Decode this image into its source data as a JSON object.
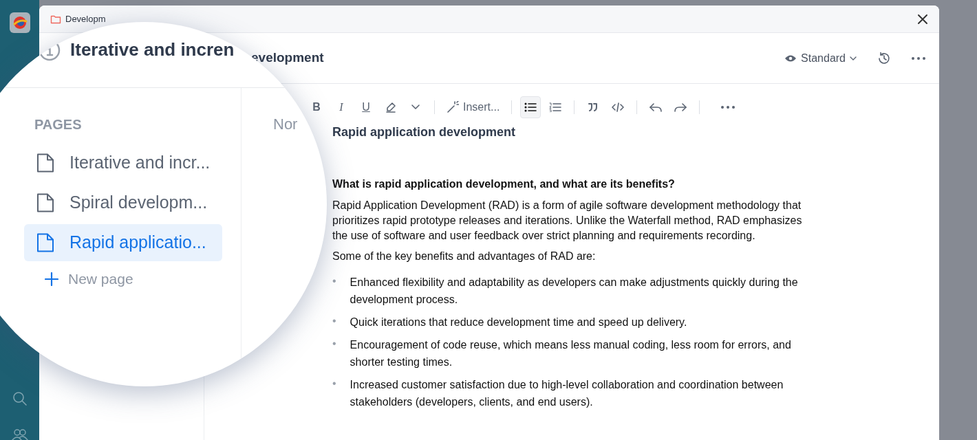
{
  "window": {
    "breadcrumb": "Developm",
    "title": "evelopment",
    "view_mode": "Standard"
  },
  "toolbar": [
    {
      "kind": "bold",
      "label": "B",
      "selected": false
    },
    {
      "kind": "italic",
      "label": "I",
      "selected": false
    },
    {
      "kind": "underline",
      "label": "U",
      "selected": false
    },
    {
      "kind": "highlight",
      "selected": false
    },
    {
      "kind": "dropdown",
      "selected": false
    },
    {
      "kind": "separator"
    },
    {
      "kind": "insert",
      "label": "Insert...",
      "selected": false
    },
    {
      "kind": "separator"
    },
    {
      "kind": "bullets",
      "selected": true
    },
    {
      "kind": "numbers",
      "selected": false
    },
    {
      "kind": "separator"
    },
    {
      "kind": "quote",
      "selected": false
    },
    {
      "kind": "code",
      "selected": false
    },
    {
      "kind": "separator"
    },
    {
      "kind": "undo",
      "selected": false
    },
    {
      "kind": "redo",
      "selected": false
    },
    {
      "kind": "separator"
    },
    {
      "kind": "more",
      "selected": false
    }
  ],
  "document": {
    "heading": "Rapid application development",
    "subheading": "What is rapid application development, and what are its benefits?",
    "marker": "•",
    "paragraphs": [
      "Rapid Application Development (RAD) is a form of agile software development methodology that prioritizes rapid prototype releases and iterations. Unlike the Waterfall method, RAD emphasizes the use of software and user feedback over strict planning and requirements recording.",
      "Some of the key benefits and advantages of RAD are:"
    ],
    "bullets": [
      "Enhanced flexibility and adaptability as developers can make adjustments quickly during the development process.",
      "Quick iterations that reduce development time and speed up delivery.",
      "Encouragement of code reuse, which means less manual coding, less room for errors, and shorter testing times.",
      "Increased customer satisfaction due to high-level collaboration and coordination between stakeholders (developers, clients, and end users)."
    ]
  },
  "magnifier": {
    "title": "Iterative and incren",
    "section_label": "PAGES",
    "pages": [
      {
        "label": "Iterative and incr...",
        "selected": false
      },
      {
        "label": "Spiral developm...",
        "selected": false
      },
      {
        "label": "Rapid applicatio...",
        "selected": true
      }
    ],
    "new_page": "New page",
    "style_label": "Nor"
  }
}
